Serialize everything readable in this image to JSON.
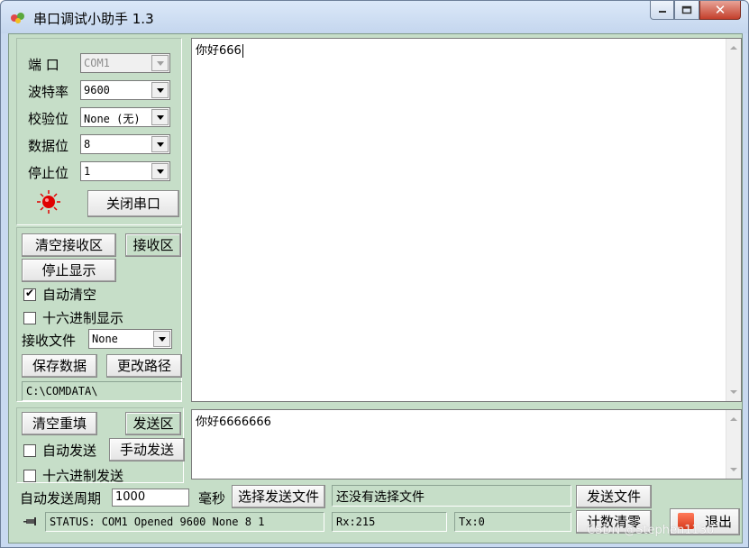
{
  "window": {
    "title": "串口调试小助手 1.3"
  },
  "settings": {
    "port_label": "端  口",
    "port_value": "COM1",
    "baud_label": "波特率",
    "baud_value": "9600",
    "parity_label": "校验位",
    "parity_value": "None (无)",
    "databits_label": "数据位",
    "databits_value": "8",
    "stopbits_label": "停止位",
    "stopbits_value": "1",
    "close_port_button": "关闭串口"
  },
  "receive": {
    "clear_button": "清空接收区",
    "area_label_button": "接收区",
    "stop_display_button": "停止显示",
    "auto_clear_label": "自动清空",
    "auto_clear_checked": true,
    "hex_display_label": "十六进制显示",
    "file_label": "接收文件",
    "file_value": "None",
    "save_button": "保存数据",
    "change_path_button": "更改路径",
    "path": "C:\\COMDATA\\",
    "text": "你好666"
  },
  "send": {
    "clear_button": "清空重填",
    "area_label_button": "发送区",
    "auto_send_label": "自动发送",
    "manual_send_button": "手动发送",
    "hex_send_label": "十六进制发送",
    "period_label": "自动发送周期",
    "period_value": "1000",
    "ms_label": "毫秒",
    "choose_file_button": "选择发送文件",
    "file_status": "还没有选择文件",
    "send_file_button": "发送文件",
    "text": "你好6666666"
  },
  "status": {
    "text": "STATUS: COM1 Opened 9600 None  8 1",
    "rx": "Rx:215",
    "tx": "Tx:0",
    "reset_counter_button": "计数清零",
    "exit_button": "退出"
  },
  "watermark": "CSDN @Stephen1130",
  "colors": {
    "panel_bg": "#c6dec8",
    "led": "#e00000"
  }
}
